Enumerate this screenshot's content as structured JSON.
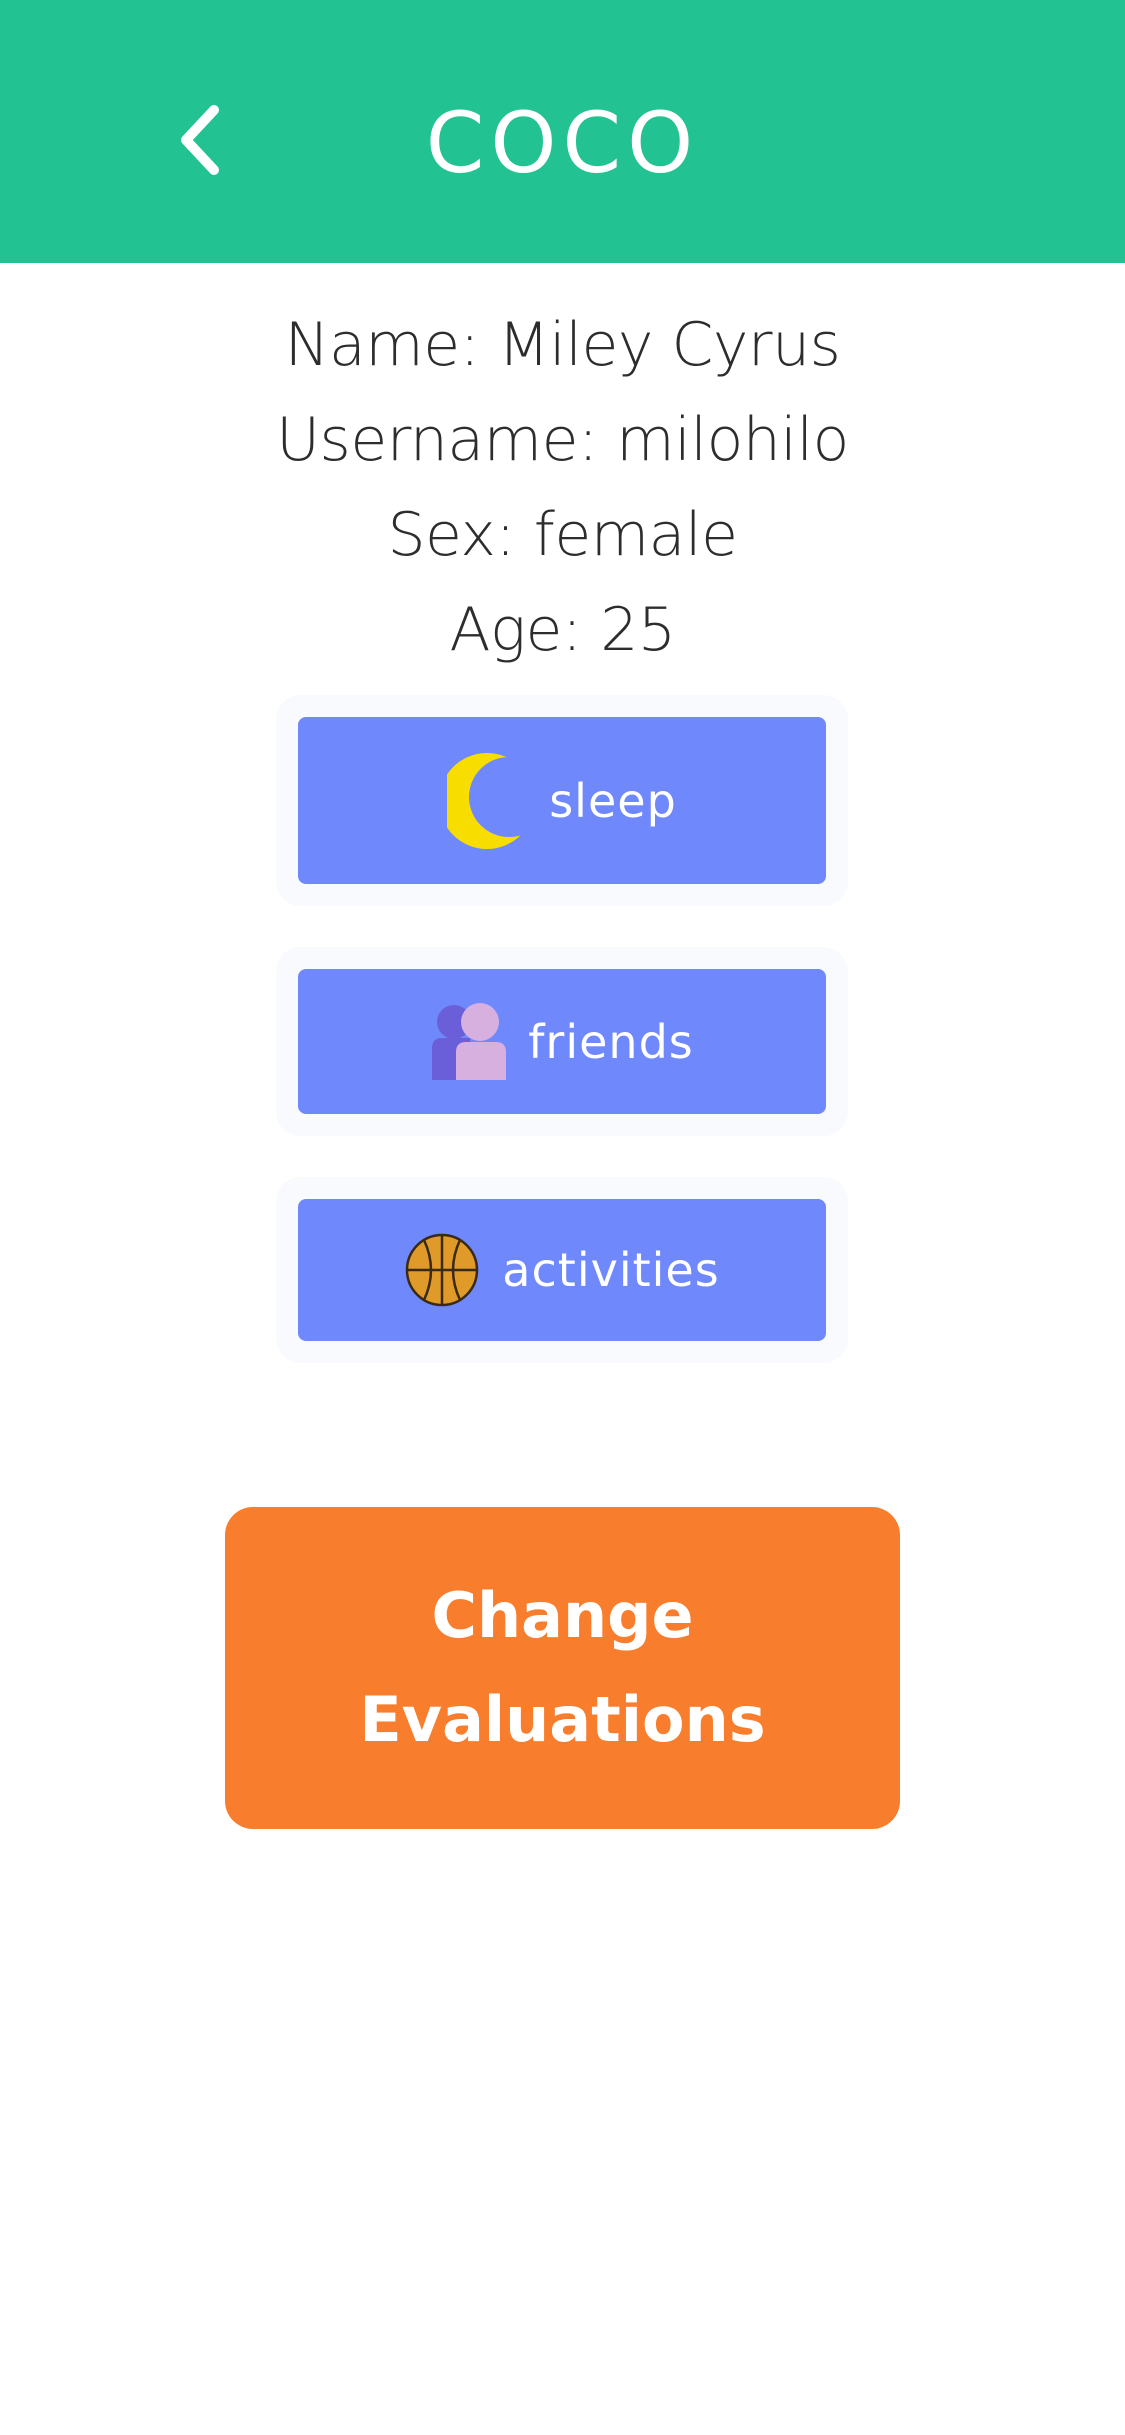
{
  "header": {
    "title": "COCO",
    "back_icon": "chevron-left-icon",
    "background_color": "#22c293"
  },
  "profile": {
    "name_line": "Name: Miley Cyrus",
    "username_line": "Username: milohilo",
    "sex_line": "Sex: female",
    "age_line": "Age: 25"
  },
  "categories": [
    {
      "label": "sleep",
      "icon": "moon-icon"
    },
    {
      "label": "friends",
      "icon": "friends-icon"
    },
    {
      "label": "activities",
      "icon": "basketball-icon"
    }
  ],
  "colors": {
    "category_button": "#6f88fc",
    "primary_button": "#f87d2c",
    "moon": "#f7de00"
  },
  "primary_button": {
    "line1": "Change",
    "line2": "Evaluations"
  }
}
